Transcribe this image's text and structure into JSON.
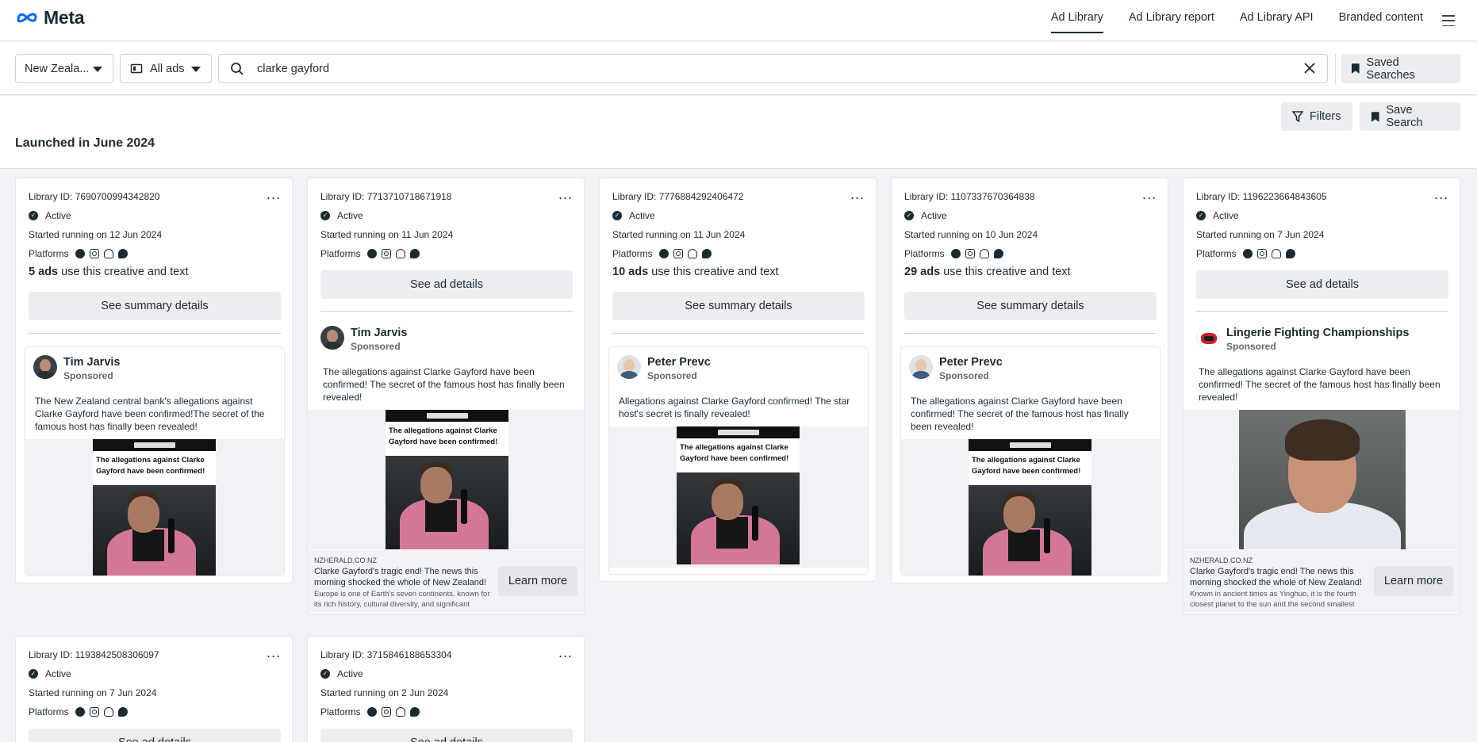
{
  "nav": {
    "brand": "Meta",
    "links": [
      "Ad Library",
      "Ad Library report",
      "Ad Library API",
      "Branded content"
    ]
  },
  "search": {
    "country": "New Zeala...",
    "ad_type": "All ads",
    "query": "clarke gayford",
    "saved_searches": "Saved Searches"
  },
  "toolbar": {
    "filters": "Filters",
    "save_search": "Save Search",
    "section_title": "Launched in June 2024"
  },
  "labels": {
    "library_id_prefix": "Library ID: ",
    "status": "Active",
    "platforms": "Platforms",
    "sponsored": "Sponsored",
    "summary_btn": "See summary details",
    "ad_btn": "See ad details",
    "use_text": "use this creative and text",
    "learn_more": "Learn more",
    "more": "..."
  },
  "cards": [
    {
      "library_id": "Library ID: 7690700994342820",
      "started": "Started running on 12 Jun 2024",
      "ads_count": "5 ads",
      "advertiser": "Tim Jarvis",
      "copy": "The New Zealand central bank's allegations against Clarke Gayford have been confirmed!The secret of the famous host has finally been revealed!",
      "thumb_headline": "The allegations against Clarke Gayford have been confirmed!"
    },
    {
      "library_id": "Library ID: 7713710718671918",
      "started": "Started running on 11 Jun 2024",
      "advertiser": "Tim Jarvis",
      "copy": "The allegations against Clarke Gayford have been confirmed! The secret of the famous host has finally been revealed!",
      "thumb_headline": "The allegations against Clarke Gayford have been confirmed!",
      "link_domain": "NZHERALD.CO.NZ",
      "link_title": "Clarke Gayford's tragic end! The news this morning shocked the whole of New Zealand!",
      "link_desc": "Europe is one of Earth's seven continents, known for its rich history, cultural diversity, and significant influence ..."
    },
    {
      "library_id": "Library ID: 7776884292406472",
      "started": "Started running on 11 Jun 2024",
      "ads_count": "10 ads",
      "advertiser": "Peter Prevc",
      "copy": "Allegations against Clarke Gayford confirmed! The star host's secret is finally revealed!",
      "thumb_headline": "The allegations against Clarke Gayford have been confirmed!"
    },
    {
      "library_id": "Library ID: 1107337670364838",
      "started": "Started running on 10 Jun 2024",
      "ads_count": "29 ads",
      "advertiser": "Peter Prevc",
      "copy": "The allegations against Clarke Gayford have been confirmed! The secret of the famous host has finally been revealed!",
      "thumb_headline": "The allegations against Clarke Gayford have been confirmed!"
    },
    {
      "library_id": "Library ID: 1196223664843605",
      "started": "Started running on 7 Jun 2024",
      "advertiser": "Lingerie Fighting Championships",
      "copy": "The allegations against Clarke Gayford have been confirmed! The secret of the famous host has finally been revealed!",
      "link_domain": "NZHERALD.CO.NZ",
      "link_title": "Clarke Gayford's tragic end! The news this morning shocked the whole of New Zealand!",
      "link_desc": "Known in ancient times as Yinghuo, it is the fourth closest planet to the sun and the second smallest plan..."
    },
    {
      "library_id": "Library ID: 1193842508306097",
      "started": "Started running on 7 Jun 2024"
    },
    {
      "library_id": "Library ID: 3715846188653304",
      "started": "Started running on 2 Jun 2024"
    }
  ],
  "colors": {
    "text": "#1c2b33",
    "page_bg": "#f0f2f5",
    "button_bg": "#ebedf0"
  }
}
